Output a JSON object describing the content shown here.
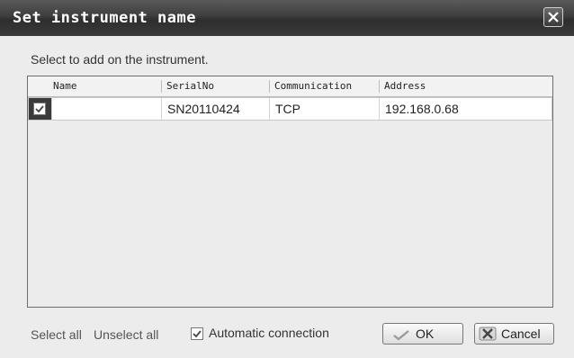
{
  "dialog": {
    "title": "Set instrument name",
    "hint": "Select to add on the instrument."
  },
  "table": {
    "columns": [
      "Name",
      "SerialNo",
      "Communication",
      "Address"
    ],
    "rows": [
      {
        "checked": true,
        "name": "",
        "serial": "SN20110424",
        "communication": "TCP",
        "address": "192.168.0.68"
      }
    ]
  },
  "footer": {
    "select_all": "Select all",
    "unselect_all": "Unselect all",
    "auto_connect_label": "Automatic connection",
    "auto_connect_checked": true,
    "ok_label": "OK",
    "cancel_label": "Cancel"
  }
}
